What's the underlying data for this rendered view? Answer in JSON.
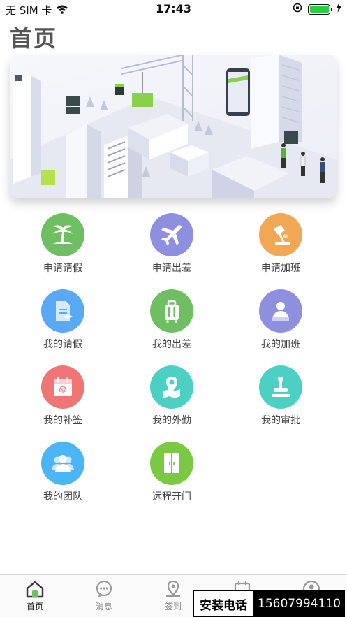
{
  "status_bar": {
    "carrier": "无 SIM 卡",
    "time": "17:43"
  },
  "header": {
    "title": "首页"
  },
  "grid": [
    {
      "label": "申请请假",
      "icon": "palm-tree-icon",
      "color": "#6dbf62"
    },
    {
      "label": "申请出差",
      "icon": "airplane-icon",
      "color": "#8f8fe0"
    },
    {
      "label": "申请加班",
      "icon": "desk-lamp-icon",
      "color": "#f2a754"
    },
    {
      "label": "我的请假",
      "icon": "document-icon",
      "color": "#5aa9f4"
    },
    {
      "label": "我的出差",
      "icon": "suitcase-icon",
      "color": "#6dbf62"
    },
    {
      "label": "我的加班",
      "icon": "worker-icon",
      "color": "#8f8fe0"
    },
    {
      "label": "我的补签",
      "icon": "calendar-fingerprint-icon",
      "color": "#f07575"
    },
    {
      "label": "我的外勤",
      "icon": "map-pin-icon",
      "color": "#4dd0c4"
    },
    {
      "label": "我的审批",
      "icon": "stamp-icon",
      "color": "#4dd0c4"
    },
    {
      "label": "我的团队",
      "icon": "team-icon",
      "color": "#4ab6f5"
    },
    {
      "label": "远程开门",
      "icon": "door-icon",
      "color": "#7ac943"
    }
  ],
  "tab_bar": {
    "tabs": [
      {
        "label": "首页",
        "icon": "home-icon"
      },
      {
        "label": "消息",
        "icon": "message-icon"
      },
      {
        "label": "签到",
        "icon": "location-icon"
      },
      {
        "label": "",
        "icon": "calendar-icon"
      },
      {
        "label": "",
        "icon": "user-icon"
      }
    ]
  },
  "overlay": {
    "label": "安装电话",
    "phone": "15607994110"
  }
}
